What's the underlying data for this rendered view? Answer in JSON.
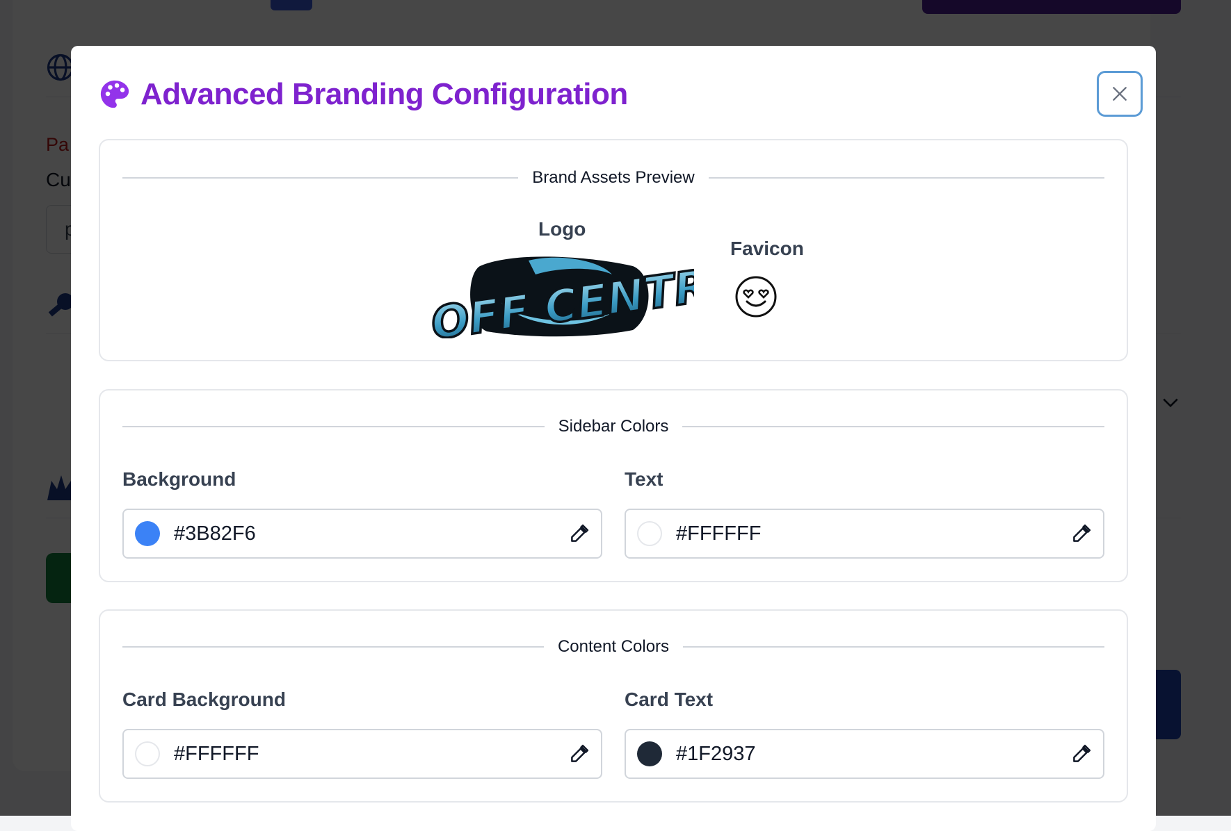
{
  "modal": {
    "title": "Advanced Branding Configuration",
    "title_icon": "palette-icon",
    "close_icon": "close-icon"
  },
  "brand_assets": {
    "legend": "Brand Assets Preview",
    "logo_label": "Logo",
    "logo_text": "OFF CENTRE",
    "favicon_label": "Favicon",
    "favicon_icon": "smiling-face-with-heart-eyes-icon"
  },
  "sidebar_colors": {
    "legend": "Sidebar Colors",
    "background": {
      "label": "Background",
      "value": "#3B82F6",
      "swatch": "#3B82F6"
    },
    "text": {
      "label": "Text",
      "value": "#FFFFFF",
      "swatch": "#FFFFFF"
    }
  },
  "content_colors": {
    "legend": "Content Colors",
    "card_background": {
      "label": "Card Background",
      "value": "#FFFFFF",
      "swatch": "#FFFFFF"
    },
    "card_text": {
      "label": "Card Text",
      "value": "#1F2937",
      "swatch": "#1F2937"
    }
  },
  "background_page": {
    "partial_text_1": "Pa",
    "partial_text_2": "Cu",
    "partial_input_value": "p"
  },
  "colors": {
    "accent": "#7E22CE",
    "focus_ring": "#5B9BD5"
  }
}
